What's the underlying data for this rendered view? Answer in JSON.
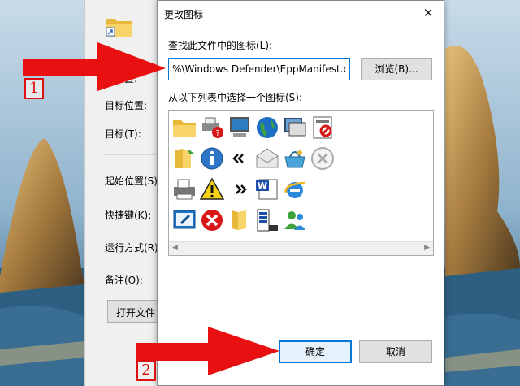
{
  "properties_window": {
    "fields": [
      {
        "label": "目标位置:"
      },
      {
        "label": "目标(T):"
      },
      {
        "label": "起始位置(S):"
      },
      {
        "label": "快捷键(K):"
      },
      {
        "label": "运行方式(R):"
      },
      {
        "label": "备注(O):"
      }
    ],
    "partial_label": "置:",
    "open_file_button": "打开文件"
  },
  "dialog": {
    "title": "更改图标",
    "close_glyph": "✕",
    "find_label": "查找此文件中的图标(L):",
    "path_value": "%\\Windows Defender\\EppManifest.dll",
    "browse_label": "浏览(B)...",
    "list_label": "从以下列表中选择一个图标(S):",
    "ok_label": "确定",
    "cancel_label": "取消",
    "icons": [
      [
        "folder-icon",
        "network-printer-error-icon",
        "computer-monitor-icon",
        "globe-icon",
        "screens-icon",
        "document-blocked-icon"
      ],
      [
        "folder-shared-icon",
        "info-icon",
        "double-chevron-left-icon",
        "envelope-icon",
        "shopping-basket-icon",
        "cancel-circle-icon"
      ],
      [
        "printer-icon",
        "warning-icon",
        "double-chevron-right-icon",
        "word-document-icon",
        "internet-explorer-icon"
      ],
      [
        "monitor-edit-icon",
        "error-icon",
        "folders-icon",
        "server-list-icon",
        "users-icon"
      ]
    ]
  },
  "annotations": {
    "step1": "1",
    "step2": "2",
    "arrow_color": "#e81010"
  }
}
